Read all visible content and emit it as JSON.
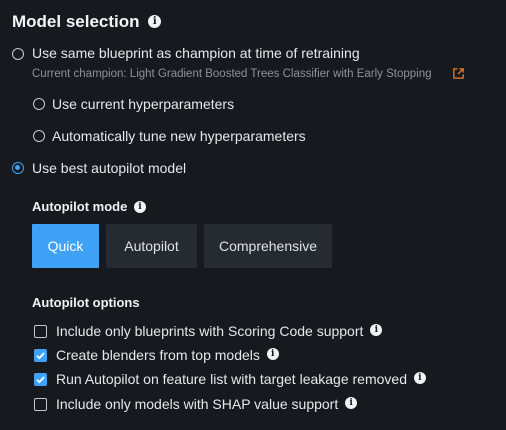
{
  "header": {
    "title": "Model selection",
    "info_glyph": "i"
  },
  "options": {
    "same_blueprint": {
      "label": "Use same blueprint as champion at time of retraining",
      "sublabel": "Current champion: Light Gradient Boosted Trees Classifier with Early Stopping",
      "selected": false
    },
    "current_hyper": {
      "label": "Use current hyperparameters",
      "selected": false
    },
    "auto_tune": {
      "label": "Automatically tune new hyperparameters",
      "selected": false
    },
    "best_autopilot": {
      "label": "Use best autopilot model",
      "selected": true
    }
  },
  "autopilot_mode": {
    "title": "Autopilot mode",
    "buttons": [
      {
        "label": "Quick",
        "active": true
      },
      {
        "label": "Autopilot",
        "active": false
      },
      {
        "label": "Comprehensive",
        "active": false
      }
    ]
  },
  "autopilot_options": {
    "title": "Autopilot options",
    "items": [
      {
        "label": "Include only blueprints with Scoring Code support",
        "checked": false
      },
      {
        "label": "Create blenders from top models",
        "checked": true
      },
      {
        "label": "Run Autopilot on feature list with target leakage removed",
        "checked": true
      },
      {
        "label": "Include only models with SHAP value support",
        "checked": false
      }
    ]
  },
  "colors": {
    "accent": "#3fa2f7",
    "background": "#16191e",
    "link_icon": "#f07a2e"
  }
}
